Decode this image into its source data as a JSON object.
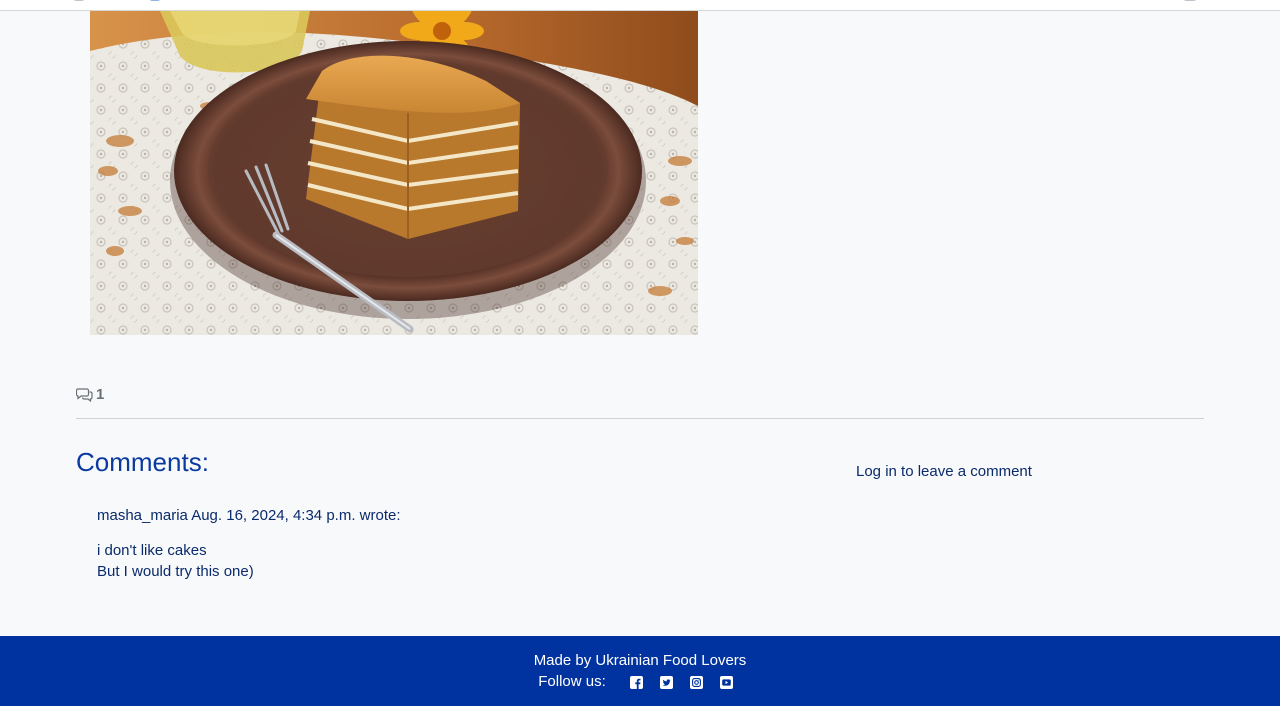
{
  "post": {
    "image_alt": "Honey cake slice on a brown plate with a fork"
  },
  "stats": {
    "comment_count": "1"
  },
  "comments_section": {
    "heading": "Comments:",
    "login_link": "Log in to leave a comment",
    "items": [
      {
        "meta": "masha_maria Aug. 16, 2024, 4:34 p.m. wrote:",
        "lines": [
          "i don't like cakes",
          "But I would try this one)"
        ]
      }
    ]
  },
  "footer": {
    "made_by": "Made by Ukrainian Food Lovers",
    "follow_label": "Follow us:",
    "social": [
      "facebook-icon",
      "twitter-icon",
      "instagram-icon",
      "youtube-icon"
    ]
  },
  "colors": {
    "footer_bg": "#0033a0",
    "heading": "#0a3aa0",
    "text": "#0a2a6b",
    "page_bg": "#f8f9fb"
  }
}
